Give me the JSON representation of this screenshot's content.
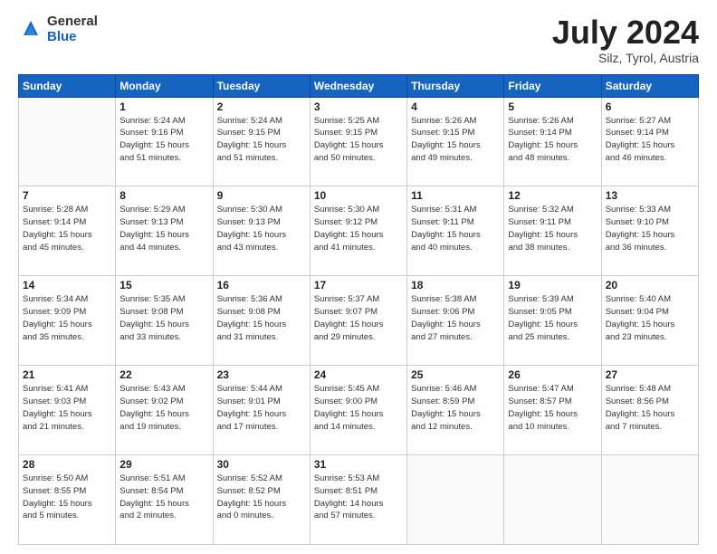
{
  "header": {
    "logo_general": "General",
    "logo_blue": "Blue",
    "month_title": "July 2024",
    "location": "Silz, Tyrol, Austria"
  },
  "days_of_week": [
    "Sunday",
    "Monday",
    "Tuesday",
    "Wednesday",
    "Thursday",
    "Friday",
    "Saturday"
  ],
  "weeks": [
    [
      {
        "day": "",
        "info": ""
      },
      {
        "day": "1",
        "info": "Sunrise: 5:24 AM\nSunset: 9:16 PM\nDaylight: 15 hours\nand 51 minutes."
      },
      {
        "day": "2",
        "info": "Sunrise: 5:24 AM\nSunset: 9:15 PM\nDaylight: 15 hours\nand 51 minutes."
      },
      {
        "day": "3",
        "info": "Sunrise: 5:25 AM\nSunset: 9:15 PM\nDaylight: 15 hours\nand 50 minutes."
      },
      {
        "day": "4",
        "info": "Sunrise: 5:26 AM\nSunset: 9:15 PM\nDaylight: 15 hours\nand 49 minutes."
      },
      {
        "day": "5",
        "info": "Sunrise: 5:26 AM\nSunset: 9:14 PM\nDaylight: 15 hours\nand 48 minutes."
      },
      {
        "day": "6",
        "info": "Sunrise: 5:27 AM\nSunset: 9:14 PM\nDaylight: 15 hours\nand 46 minutes."
      }
    ],
    [
      {
        "day": "7",
        "info": "Sunrise: 5:28 AM\nSunset: 9:14 PM\nDaylight: 15 hours\nand 45 minutes."
      },
      {
        "day": "8",
        "info": "Sunrise: 5:29 AM\nSunset: 9:13 PM\nDaylight: 15 hours\nand 44 minutes."
      },
      {
        "day": "9",
        "info": "Sunrise: 5:30 AM\nSunset: 9:13 PM\nDaylight: 15 hours\nand 43 minutes."
      },
      {
        "day": "10",
        "info": "Sunrise: 5:30 AM\nSunset: 9:12 PM\nDaylight: 15 hours\nand 41 minutes."
      },
      {
        "day": "11",
        "info": "Sunrise: 5:31 AM\nSunset: 9:11 PM\nDaylight: 15 hours\nand 40 minutes."
      },
      {
        "day": "12",
        "info": "Sunrise: 5:32 AM\nSunset: 9:11 PM\nDaylight: 15 hours\nand 38 minutes."
      },
      {
        "day": "13",
        "info": "Sunrise: 5:33 AM\nSunset: 9:10 PM\nDaylight: 15 hours\nand 36 minutes."
      }
    ],
    [
      {
        "day": "14",
        "info": "Sunrise: 5:34 AM\nSunset: 9:09 PM\nDaylight: 15 hours\nand 35 minutes."
      },
      {
        "day": "15",
        "info": "Sunrise: 5:35 AM\nSunset: 9:08 PM\nDaylight: 15 hours\nand 33 minutes."
      },
      {
        "day": "16",
        "info": "Sunrise: 5:36 AM\nSunset: 9:08 PM\nDaylight: 15 hours\nand 31 minutes."
      },
      {
        "day": "17",
        "info": "Sunrise: 5:37 AM\nSunset: 9:07 PM\nDaylight: 15 hours\nand 29 minutes."
      },
      {
        "day": "18",
        "info": "Sunrise: 5:38 AM\nSunset: 9:06 PM\nDaylight: 15 hours\nand 27 minutes."
      },
      {
        "day": "19",
        "info": "Sunrise: 5:39 AM\nSunset: 9:05 PM\nDaylight: 15 hours\nand 25 minutes."
      },
      {
        "day": "20",
        "info": "Sunrise: 5:40 AM\nSunset: 9:04 PM\nDaylight: 15 hours\nand 23 minutes."
      }
    ],
    [
      {
        "day": "21",
        "info": "Sunrise: 5:41 AM\nSunset: 9:03 PM\nDaylight: 15 hours\nand 21 minutes."
      },
      {
        "day": "22",
        "info": "Sunrise: 5:43 AM\nSunset: 9:02 PM\nDaylight: 15 hours\nand 19 minutes."
      },
      {
        "day": "23",
        "info": "Sunrise: 5:44 AM\nSunset: 9:01 PM\nDaylight: 15 hours\nand 17 minutes."
      },
      {
        "day": "24",
        "info": "Sunrise: 5:45 AM\nSunset: 9:00 PM\nDaylight: 15 hours\nand 14 minutes."
      },
      {
        "day": "25",
        "info": "Sunrise: 5:46 AM\nSunset: 8:59 PM\nDaylight: 15 hours\nand 12 minutes."
      },
      {
        "day": "26",
        "info": "Sunrise: 5:47 AM\nSunset: 8:57 PM\nDaylight: 15 hours\nand 10 minutes."
      },
      {
        "day": "27",
        "info": "Sunrise: 5:48 AM\nSunset: 8:56 PM\nDaylight: 15 hours\nand 7 minutes."
      }
    ],
    [
      {
        "day": "28",
        "info": "Sunrise: 5:50 AM\nSunset: 8:55 PM\nDaylight: 15 hours\nand 5 minutes."
      },
      {
        "day": "29",
        "info": "Sunrise: 5:51 AM\nSunset: 8:54 PM\nDaylight: 15 hours\nand 2 minutes."
      },
      {
        "day": "30",
        "info": "Sunrise: 5:52 AM\nSunset: 8:52 PM\nDaylight: 15 hours\nand 0 minutes."
      },
      {
        "day": "31",
        "info": "Sunrise: 5:53 AM\nSunset: 8:51 PM\nDaylight: 14 hours\nand 57 minutes."
      },
      {
        "day": "",
        "info": ""
      },
      {
        "day": "",
        "info": ""
      },
      {
        "day": "",
        "info": ""
      }
    ]
  ]
}
